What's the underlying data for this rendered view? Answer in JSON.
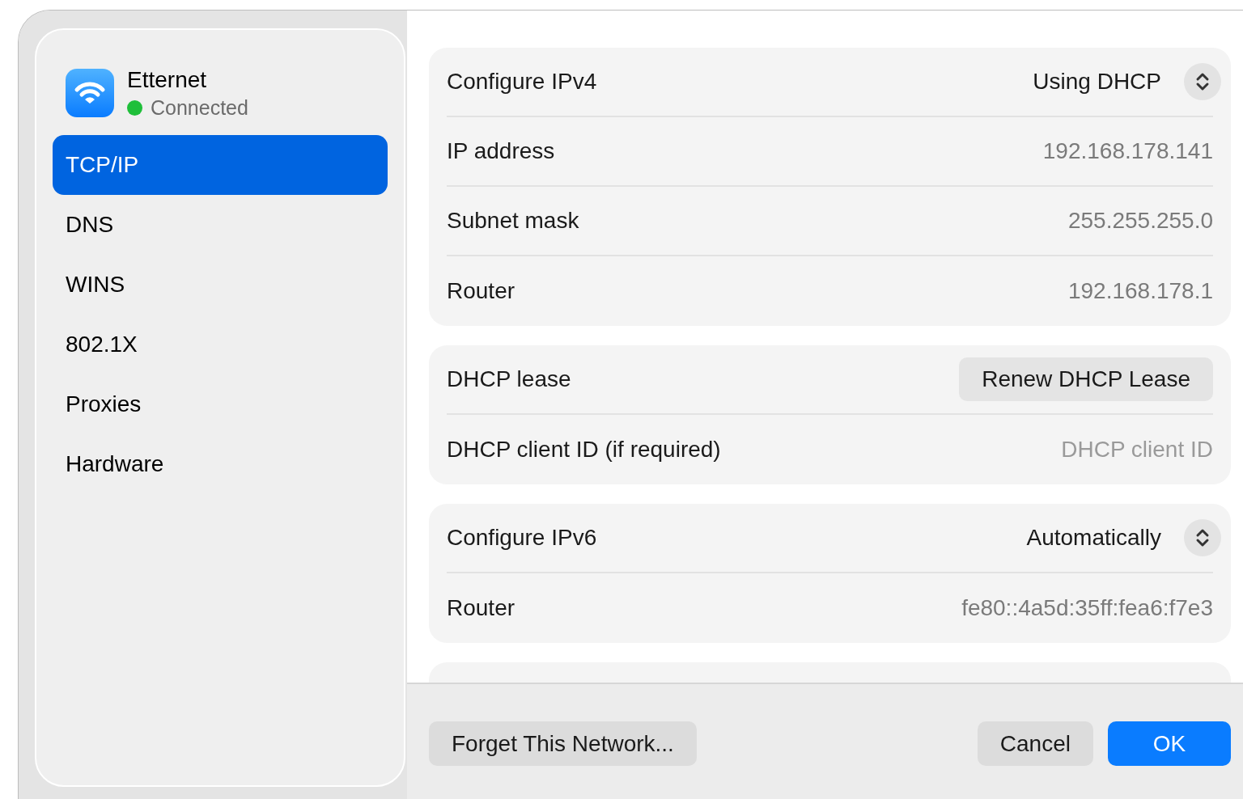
{
  "sidebar": {
    "title": "Etternet",
    "status": "Connected",
    "connected": true,
    "items": [
      {
        "label": "TCP/IP",
        "selected": true
      },
      {
        "label": "DNS",
        "selected": false
      },
      {
        "label": "WINS",
        "selected": false
      },
      {
        "label": "802.1X",
        "selected": false
      },
      {
        "label": "Proxies",
        "selected": false
      },
      {
        "label": "Hardware",
        "selected": false
      }
    ]
  },
  "sections": [
    {
      "rows": [
        {
          "kind": "popup",
          "label": "Configure IPv4",
          "value": "Using DHCP"
        },
        {
          "kind": "text",
          "label": "IP address",
          "value": "192.168.178.141"
        },
        {
          "kind": "text",
          "label": "Subnet mask",
          "value": "255.255.255.0"
        },
        {
          "kind": "text",
          "label": "Router",
          "value": "192.168.178.1"
        }
      ]
    },
    {
      "rows": [
        {
          "kind": "button",
          "label": "DHCP lease",
          "button": "Renew DHCP Lease"
        },
        {
          "kind": "field",
          "label": "DHCP client ID (if required)",
          "placeholder": "DHCP client ID"
        }
      ]
    },
    {
      "rows": [
        {
          "kind": "popup",
          "label": "Configure IPv6",
          "value": "Automatically"
        },
        {
          "kind": "text",
          "label": "Router",
          "value": "fe80::4a5d:35ff:fea6:f7e3"
        }
      ]
    }
  ],
  "footer": [
    {
      "kind": "secondary",
      "label": "Forget This Network..."
    },
    {
      "kind": "secondary",
      "label": "Cancel"
    },
    {
      "kind": "primary",
      "label": "OK"
    }
  ]
}
